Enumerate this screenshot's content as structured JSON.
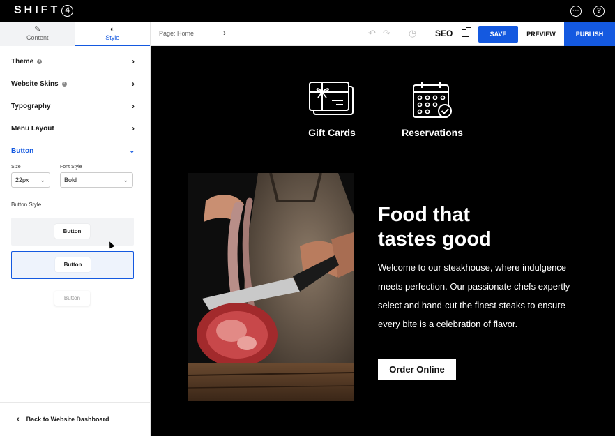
{
  "brand": {
    "name": "SHIFT",
    "badge": "4"
  },
  "top_icons": {
    "chat": "chat-icon",
    "help": "help-icon",
    "help_glyph": "?"
  },
  "panel": {
    "tabs": [
      {
        "label": "Content",
        "icon": "pencil-icon"
      },
      {
        "label": "Style",
        "icon": "contrast-icon"
      }
    ],
    "active_tab": "Style",
    "menu": [
      {
        "label": "Theme",
        "info": true
      },
      {
        "label": "Website Skins",
        "info": true
      },
      {
        "label": "Typography",
        "info": false
      },
      {
        "label": "Menu Layout",
        "info": false
      },
      {
        "label": "Button",
        "info": false,
        "expanded": true
      }
    ],
    "button_section": {
      "size_label": "Size",
      "size_value": "22px",
      "font_style_label": "Font Style",
      "font_style_value": "Bold",
      "button_style_label": "Button Style",
      "styles": [
        {
          "label": "Button",
          "selected": false
        },
        {
          "label": "Button",
          "selected": true
        },
        {
          "label": "Button",
          "selected": false
        }
      ]
    },
    "back_link": "Back to Website Dashboard"
  },
  "toolbar": {
    "page_label": "Page: Home",
    "seo_label": "SEO",
    "save_label": "SAVE",
    "preview_label": "PREVIEW",
    "publish_label": "PUBLISH"
  },
  "canvas": {
    "features": [
      {
        "label": "Gift Cards",
        "icon": "gift-card-icon"
      },
      {
        "label": "Reservations",
        "icon": "calendar-check-icon"
      }
    ],
    "hero": {
      "title_line1": "Food that",
      "title_line2": "tastes good",
      "body": "Welcome to our steakhouse, where indulgence meets perfection. Our passionate chefs expertly select and hand-cut the finest steaks to ensure every bite is a celebration of flavor.",
      "cta_label": "Order Online"
    }
  },
  "colors": {
    "accent": "#1459e0",
    "canvas_bg": "#000000",
    "selected_style_bg": "#eef3fc"
  }
}
